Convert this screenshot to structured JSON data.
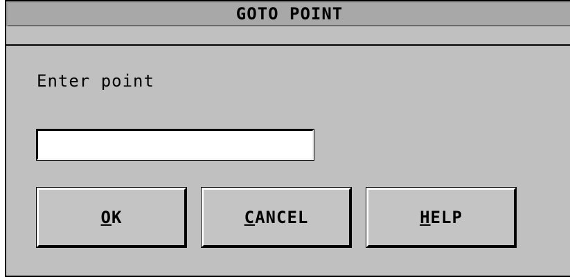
{
  "dialog": {
    "title": "GOTO POINT",
    "prompt": "Enter point",
    "input": {
      "value": "",
      "placeholder": ""
    },
    "buttons": {
      "ok": {
        "mnemonic": "O",
        "rest": "K"
      },
      "cancel": {
        "mnemonic": "C",
        "rest": "ANCEL"
      },
      "help": {
        "mnemonic": "H",
        "rest": "ELP"
      }
    }
  },
  "colors": {
    "dialog_background": "#c0c0c0",
    "titlebar_background": "#a8a8a8",
    "input_background": "#ffffff",
    "border": "#000000"
  }
}
